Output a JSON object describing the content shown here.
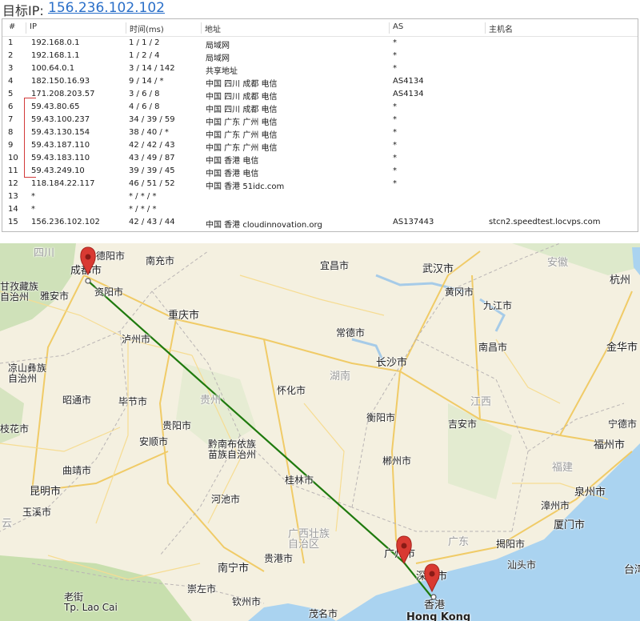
{
  "header": {
    "label": "目标IP:",
    "ip": "156.236.102.102"
  },
  "table": {
    "columns": [
      "#",
      "IP",
      "时间(ms)",
      "地址",
      "AS",
      "主机名"
    ],
    "rows": [
      [
        "1",
        "192.168.0.1",
        "1 / 1 / 2",
        "局域网",
        "*",
        ""
      ],
      [
        "2",
        "192.168.1.1",
        "1 / 2 / 4",
        "局域网",
        "*",
        ""
      ],
      [
        "3",
        "100.64.0.1",
        "3 / 14 / 142",
        "共享地址",
        "*",
        ""
      ],
      [
        "4",
        "182.150.16.93",
        "9 / 14 / *",
        "中国 四川 成都 电信",
        "AS4134",
        ""
      ],
      [
        "5",
        "171.208.203.57",
        "3 / 6 / 8",
        "中国 四川 成都 电信",
        "AS4134",
        ""
      ],
      [
        "6",
        "59.43.80.65",
        "4 / 6 / 8",
        "中国 四川 成都 电信",
        "*",
        ""
      ],
      [
        "7",
        "59.43.100.237",
        "34 / 39 / 59",
        "中国 广东 广州 电信",
        "*",
        ""
      ],
      [
        "8",
        "59.43.130.154",
        "38 / 40 / *",
        "中国 广东 广州 电信",
        "*",
        ""
      ],
      [
        "9",
        "59.43.187.110",
        "42 / 42 / 43",
        "中国 广东 广州 电信",
        "*",
        ""
      ],
      [
        "10",
        "59.43.183.110",
        "43 / 49 / 87",
        "中国 香港 电信",
        "*",
        ""
      ],
      [
        "11",
        "59.43.249.10",
        "39 / 39 / 45",
        "中国 香港 电信",
        "*",
        ""
      ],
      [
        "12",
        "118.184.22.117",
        "46 / 51 / 52",
        "中国 香港 51idc.com",
        "*",
        ""
      ],
      [
        "13",
        "*",
        "* / * / *",
        "",
        "",
        ""
      ],
      [
        "14",
        "*",
        "* / * / *",
        "",
        "",
        ""
      ],
      [
        "15",
        "156.236.102.102",
        "42 / 43 / 44",
        "中国 香港 cloudinnovation.org",
        "AS137443",
        "stcn2.speedtest.locvps.com"
      ]
    ]
  },
  "map": {
    "labels": {
      "sichuan": "四川",
      "deyang": "德阳市",
      "nanchong": "南充市",
      "yichang": "宜昌市",
      "wuhan": "武汉市",
      "anhui": "安徽",
      "hangzhou": "杭州",
      "chengdu": "成都市",
      "ganzi": "甘孜藏族\n自治州",
      "yaan": "雅安市",
      "ziyang": "资阳市",
      "huanggang": "黄冈市",
      "jiujiang": "九江市",
      "chongqing": "重庆市",
      "luzhou": "泸州市",
      "changde": "常德市",
      "nanchang": "南昌市",
      "jinhua": "金华市",
      "liangshan": "凉山彝族\n自治州",
      "changsha": "长沙市",
      "hunan": "湖南",
      "zhaotong": "昭通市",
      "bijie": "毕节市",
      "guizhou": "贵州",
      "huaihua": "怀化市",
      "jiangxi": "江西",
      "panzhihua": "枝花市",
      "guiyang": "贵阳市",
      "hengyang": "衡阳市",
      "jian": "吉安市",
      "ningde": "宁德市",
      "anshun": "安顺市",
      "qiannan": "黔南布依族\n苗族自治州",
      "fuzhou": "福州市",
      "qujing": "曲靖市",
      "chenzhou": "郴州市",
      "fujian": "福建",
      "guilin": "桂林市",
      "quanzhou": "泉州市",
      "kunming": "昆明市",
      "hechi": "河池市",
      "zhangzhou": "漳州市",
      "yuxi": "玉溪市",
      "guangxi": "广西壮族\n自治区",
      "guangdong": "广东",
      "xiamen": "厦门市",
      "jieyang": "揭阳市",
      "guangzhou": "广州市",
      "shantou": "汕头市",
      "nanning": "南宁市",
      "guigang": "贵港市",
      "shenzhen": "深圳市",
      "taiwan": "台湾",
      "chongzuo": "崇左市",
      "qinzhou": "钦州市",
      "hongkong_cn": "香港",
      "hongkong_en": "Hong Kong",
      "laocai": "老街\nTp. Lao Cai",
      "maoming": "茂名市",
      "yunnan_edge": "云"
    },
    "route_color": "#1f7a0e",
    "pin_color": "#d93a32"
  }
}
